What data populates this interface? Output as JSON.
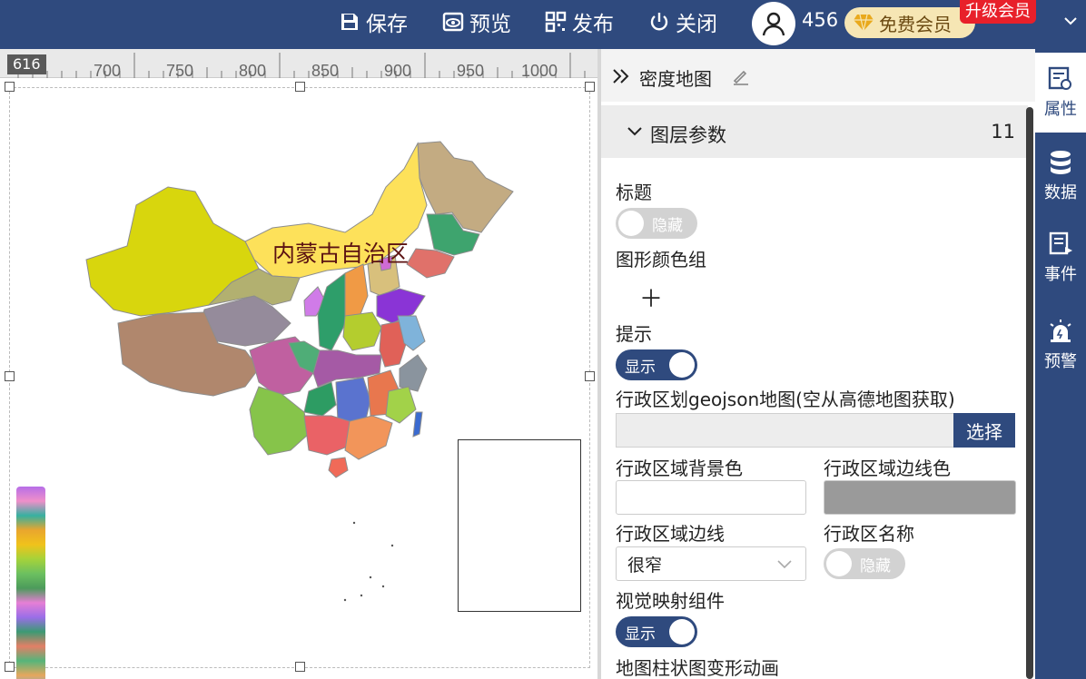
{
  "toolbar": {
    "save_label": "保存",
    "preview_label": "预览",
    "publish_label": "发布",
    "close_label": "关闭",
    "user_id": "456",
    "vip_label": "免费会员",
    "upgrade_label": "升级会员"
  },
  "ruler": {
    "current_value": "616",
    "ticks": [
      "700",
      "750",
      "800",
      "850",
      "900",
      "950",
      "1000"
    ]
  },
  "map": {
    "region_label": "内蒙古自治区"
  },
  "panel": {
    "title": "密度地图",
    "section_title": "图层参数",
    "section_count": "11",
    "title_label": "标题",
    "title_toggle": "隐藏",
    "color_group_label": "图形颜色组",
    "tooltip_label": "提示",
    "tooltip_toggle": "显示",
    "geojson_label": "行政区划geojson地图(空从高德地图获取)",
    "geojson_value": "",
    "select_button": "选择",
    "bg_color_label": "行政区域背景色",
    "border_color_label": "行政区域边线色",
    "border_label": "行政区域边线",
    "border_value": "很窄",
    "region_name_label": "行政区名称",
    "region_name_toggle": "隐藏",
    "visual_map_label": "视觉映射组件",
    "visual_map_toggle": "显示",
    "bar_anim_label": "地图柱状图变形动画"
  },
  "rail": {
    "items": [
      {
        "label": "属性",
        "icon": "property-icon"
      },
      {
        "label": "数据",
        "icon": "database-icon"
      },
      {
        "label": "事件",
        "icon": "event-icon"
      },
      {
        "label": "预警",
        "icon": "alarm-icon"
      }
    ]
  },
  "colors": {
    "primary": "#2f4a7e",
    "upgrade_red": "#e8202a",
    "vip_gold": "#f6e6b4",
    "border_color_value": "#9a9a9a",
    "bg_color_value": "#ffffff"
  }
}
